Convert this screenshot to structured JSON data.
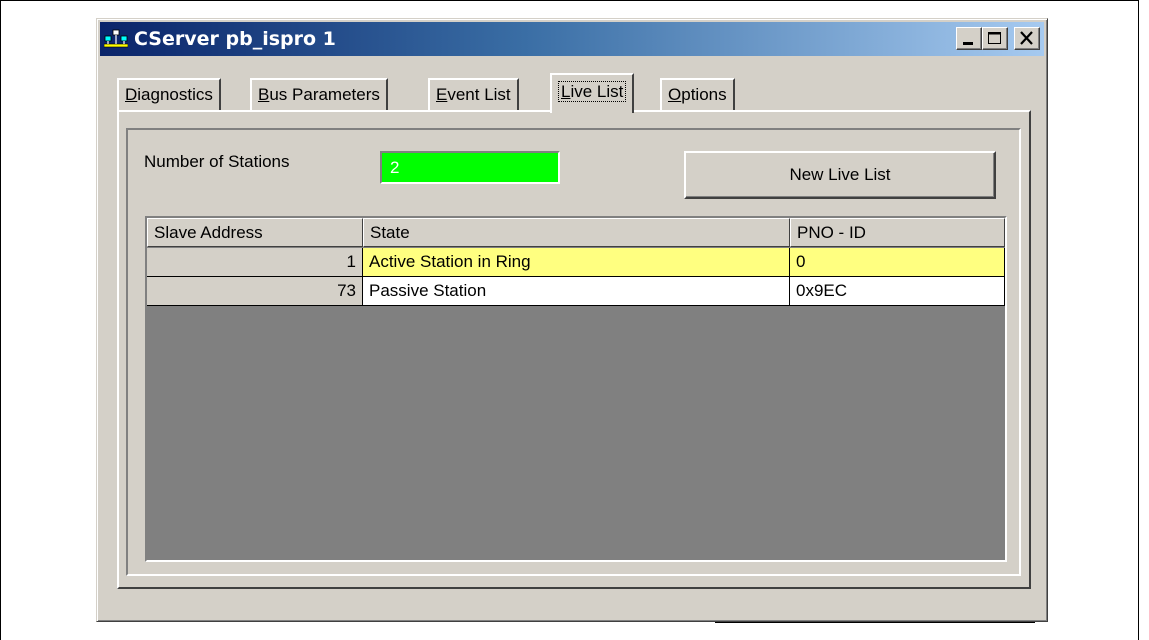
{
  "window": {
    "title": "CServer pb_ispro 1",
    "controls": {
      "minimize": "minimize",
      "maximize": "maximize",
      "close": "close"
    }
  },
  "tabs": [
    {
      "accel": "D",
      "rest": "iagnostics"
    },
    {
      "accel": "B",
      "rest": "us Parameters"
    },
    {
      "accel": "E",
      "rest": "vent  List"
    },
    {
      "accel": "L",
      "rest": "ive List",
      "active": true
    },
    {
      "accel": "O",
      "rest": "ptions"
    }
  ],
  "live_list": {
    "stations_label": "Number of Stations",
    "stations_value": "2",
    "new_button": "New Live List",
    "columns": [
      "Slave Address",
      "State",
      "PNO - ID"
    ],
    "rows": [
      {
        "address": "1",
        "state": "Active Station in Ring",
        "pno_id": "0",
        "highlighted": true
      },
      {
        "address": "73",
        "state": "Passive Station",
        "pno_id": "0x9EC",
        "highlighted": false
      }
    ]
  },
  "colors": {
    "titlebar_start": "#0a246a",
    "titlebar_end": "#a6caf0",
    "stations_field": "#00ff00",
    "row_highlight": "#ffff80",
    "grid_empty": "#808080"
  },
  "icons": {
    "app": "network-icon",
    "minimize": "minimize-icon",
    "maximize": "maximize-icon",
    "close": "close-icon"
  }
}
